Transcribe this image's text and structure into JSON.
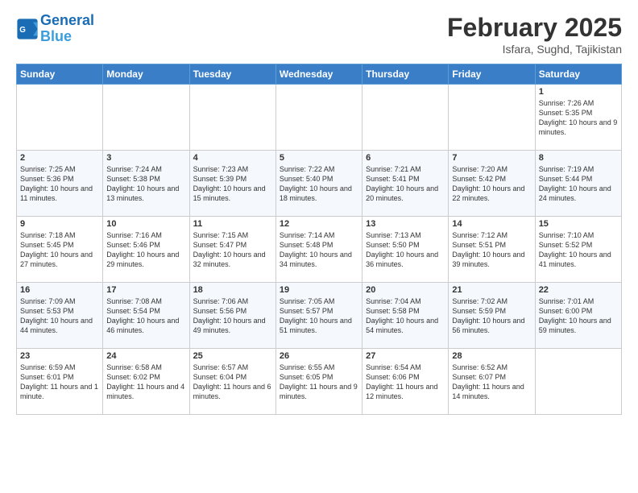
{
  "header": {
    "logo_line1": "General",
    "logo_line2": "Blue",
    "title": "February 2025",
    "subtitle": "Isfara, Sughd, Tajikistan"
  },
  "weekdays": [
    "Sunday",
    "Monday",
    "Tuesday",
    "Wednesday",
    "Thursday",
    "Friday",
    "Saturday"
  ],
  "weeks": [
    [
      {
        "day": "",
        "text": ""
      },
      {
        "day": "",
        "text": ""
      },
      {
        "day": "",
        "text": ""
      },
      {
        "day": "",
        "text": ""
      },
      {
        "day": "",
        "text": ""
      },
      {
        "day": "",
        "text": ""
      },
      {
        "day": "1",
        "text": "Sunrise: 7:26 AM\nSunset: 5:35 PM\nDaylight: 10 hours and 9 minutes."
      }
    ],
    [
      {
        "day": "2",
        "text": "Sunrise: 7:25 AM\nSunset: 5:36 PM\nDaylight: 10 hours and 11 minutes."
      },
      {
        "day": "3",
        "text": "Sunrise: 7:24 AM\nSunset: 5:38 PM\nDaylight: 10 hours and 13 minutes."
      },
      {
        "day": "4",
        "text": "Sunrise: 7:23 AM\nSunset: 5:39 PM\nDaylight: 10 hours and 15 minutes."
      },
      {
        "day": "5",
        "text": "Sunrise: 7:22 AM\nSunset: 5:40 PM\nDaylight: 10 hours and 18 minutes."
      },
      {
        "day": "6",
        "text": "Sunrise: 7:21 AM\nSunset: 5:41 PM\nDaylight: 10 hours and 20 minutes."
      },
      {
        "day": "7",
        "text": "Sunrise: 7:20 AM\nSunset: 5:42 PM\nDaylight: 10 hours and 22 minutes."
      },
      {
        "day": "8",
        "text": "Sunrise: 7:19 AM\nSunset: 5:44 PM\nDaylight: 10 hours and 24 minutes."
      }
    ],
    [
      {
        "day": "9",
        "text": "Sunrise: 7:18 AM\nSunset: 5:45 PM\nDaylight: 10 hours and 27 minutes."
      },
      {
        "day": "10",
        "text": "Sunrise: 7:16 AM\nSunset: 5:46 PM\nDaylight: 10 hours and 29 minutes."
      },
      {
        "day": "11",
        "text": "Sunrise: 7:15 AM\nSunset: 5:47 PM\nDaylight: 10 hours and 32 minutes."
      },
      {
        "day": "12",
        "text": "Sunrise: 7:14 AM\nSunset: 5:48 PM\nDaylight: 10 hours and 34 minutes."
      },
      {
        "day": "13",
        "text": "Sunrise: 7:13 AM\nSunset: 5:50 PM\nDaylight: 10 hours and 36 minutes."
      },
      {
        "day": "14",
        "text": "Sunrise: 7:12 AM\nSunset: 5:51 PM\nDaylight: 10 hours and 39 minutes."
      },
      {
        "day": "15",
        "text": "Sunrise: 7:10 AM\nSunset: 5:52 PM\nDaylight: 10 hours and 41 minutes."
      }
    ],
    [
      {
        "day": "16",
        "text": "Sunrise: 7:09 AM\nSunset: 5:53 PM\nDaylight: 10 hours and 44 minutes."
      },
      {
        "day": "17",
        "text": "Sunrise: 7:08 AM\nSunset: 5:54 PM\nDaylight: 10 hours and 46 minutes."
      },
      {
        "day": "18",
        "text": "Sunrise: 7:06 AM\nSunset: 5:56 PM\nDaylight: 10 hours and 49 minutes."
      },
      {
        "day": "19",
        "text": "Sunrise: 7:05 AM\nSunset: 5:57 PM\nDaylight: 10 hours and 51 minutes."
      },
      {
        "day": "20",
        "text": "Sunrise: 7:04 AM\nSunset: 5:58 PM\nDaylight: 10 hours and 54 minutes."
      },
      {
        "day": "21",
        "text": "Sunrise: 7:02 AM\nSunset: 5:59 PM\nDaylight: 10 hours and 56 minutes."
      },
      {
        "day": "22",
        "text": "Sunrise: 7:01 AM\nSunset: 6:00 PM\nDaylight: 10 hours and 59 minutes."
      }
    ],
    [
      {
        "day": "23",
        "text": "Sunrise: 6:59 AM\nSunset: 6:01 PM\nDaylight: 11 hours and 1 minute."
      },
      {
        "day": "24",
        "text": "Sunrise: 6:58 AM\nSunset: 6:02 PM\nDaylight: 11 hours and 4 minutes."
      },
      {
        "day": "25",
        "text": "Sunrise: 6:57 AM\nSunset: 6:04 PM\nDaylight: 11 hours and 6 minutes."
      },
      {
        "day": "26",
        "text": "Sunrise: 6:55 AM\nSunset: 6:05 PM\nDaylight: 11 hours and 9 minutes."
      },
      {
        "day": "27",
        "text": "Sunrise: 6:54 AM\nSunset: 6:06 PM\nDaylight: 11 hours and 12 minutes."
      },
      {
        "day": "28",
        "text": "Sunrise: 6:52 AM\nSunset: 6:07 PM\nDaylight: 11 hours and 14 minutes."
      },
      {
        "day": "",
        "text": ""
      }
    ]
  ]
}
